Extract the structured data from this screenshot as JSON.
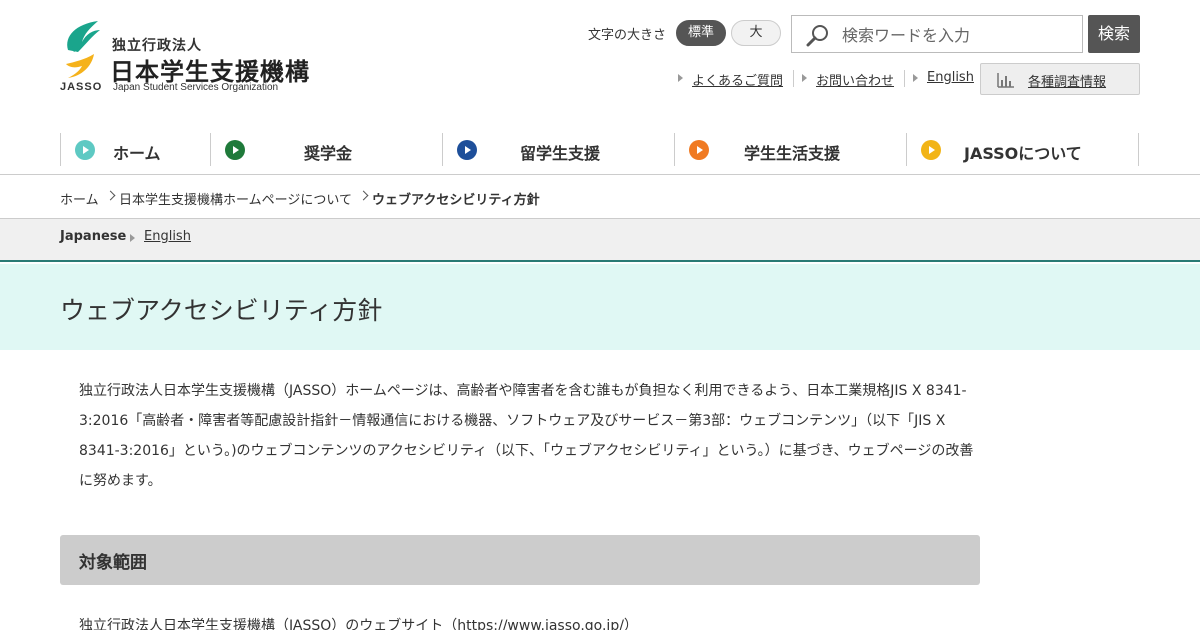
{
  "logo": {
    "org_prefix": "独立行政法人",
    "org_name": "日本学生支援機構",
    "acronym": "JASSO",
    "english_name": "Japan Student Services Organization",
    "colors": {
      "teal": "#1aa58c",
      "yellow": "#f5b21b"
    }
  },
  "font_size": {
    "label": "文字の大きさ",
    "standard": "標準",
    "large": "大"
  },
  "search": {
    "placeholder": "検索ワードを入力",
    "button": "検索",
    "icon": "search-icon"
  },
  "utility_links": {
    "faq": "よくあるご質問",
    "contact": "お問い合わせ",
    "english": "English",
    "survey": "各種調査情報",
    "survey_icon": "bar-chart-icon"
  },
  "global_nav": [
    {
      "label": "ホーム",
      "color": "#5ec9c3"
    },
    {
      "label": "奨学金",
      "color": "#1f7a3a"
    },
    {
      "label": "留学生支援",
      "color": "#1e4f9a"
    },
    {
      "label": "学生生活支援",
      "color": "#f07a22"
    },
    {
      "label": "JASSOについて",
      "color": "#f2b416"
    }
  ],
  "breadcrumb": {
    "home": "ホーム",
    "parent": "日本学生支援機構ホームページについて",
    "current": "ウェブアクセシビリティ方針"
  },
  "language": {
    "japanese": "Japanese",
    "english": "English"
  },
  "page": {
    "title": "ウェブアクセシビリティ方針",
    "intro": "独立行政法人日本学生支援機構（JASSO）ホームページは、高齢者や障害者を含む誰もが負担なく利用できるよう、日本工業規格JIS X 8341-3:2016「高齢者・障害者等配慮設計指針－情報通信における機器、ソフトウェア及びサービス－第3部：ウェブコンテンツ」（以下「JIS X 8341-3:2016」という。)のウェブコンテンツのアクセシビリティ（以下、「ウェブアクセシビリティ」という。）に基づき、ウェブページの改善に努めます。",
    "section_title": "対象範囲",
    "scope_text": "独立行政法人日本学生支援機構（JASSO）のウェブサイト（https://www.jasso.go.jp/）"
  }
}
